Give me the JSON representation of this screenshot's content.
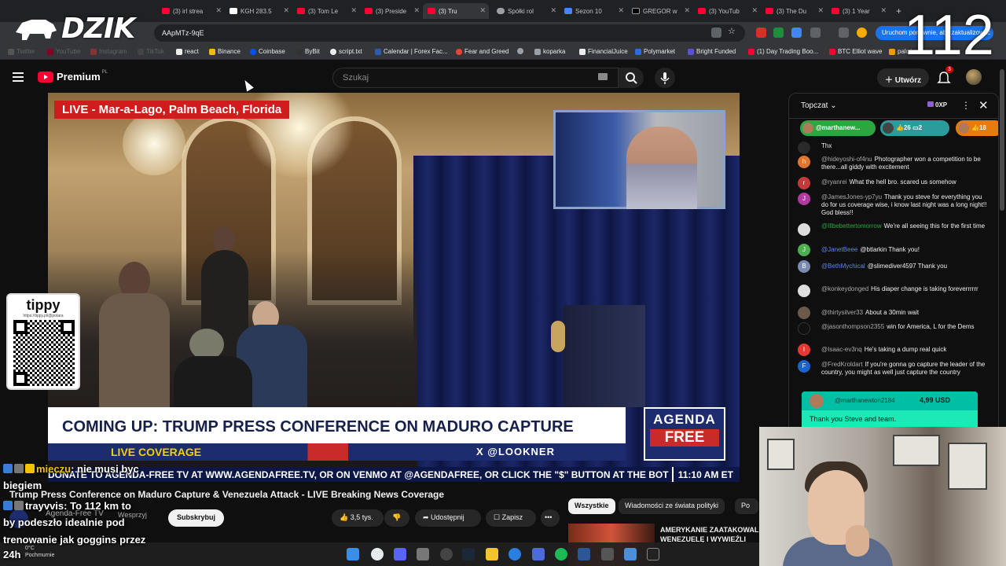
{
  "overlay": {
    "logo_text": "DZIK",
    "counter": "112"
  },
  "browser": {
    "tabs": [
      {
        "label": "(3) irl strea"
      },
      {
        "label": "KGH 283.5"
      },
      {
        "label": "(3) Tom Le"
      },
      {
        "label": "(3) Preside"
      },
      {
        "label": "(3) Tru"
      },
      {
        "label": "Spółki rol"
      },
      {
        "label": "Sezon 10"
      },
      {
        "label": "GREGOR w"
      },
      {
        "label": "(3) YouTub"
      },
      {
        "label": "(3) The Du"
      },
      {
        "label": "(3) 1 Year"
      }
    ],
    "new_tab": "+",
    "url": "AApMTz-9qE",
    "relaunch_label": "Uruchom ponownie, aby zaktualizować",
    "bookmarks": [
      {
        "label": "Twitter",
        "dim": true
      },
      {
        "label": "YouTube",
        "dim": true
      },
      {
        "label": "Instagram",
        "dim": true
      },
      {
        "label": "TikTok",
        "dim": true
      },
      {
        "label": "react",
        "dim": false
      },
      {
        "label": "Binance",
        "dim": false
      },
      {
        "label": "Coinbase",
        "dim": false
      },
      {
        "label": "ByBit",
        "dim": false
      },
      {
        "label": "script.txt",
        "dim": false
      },
      {
        "label": "Calendar | Forex Fac...",
        "dim": false
      },
      {
        "label": "Fear and Greed",
        "dim": false
      },
      {
        "label": "koparka",
        "dim": false
      },
      {
        "label": "FinancialJuice",
        "dim": false
      },
      {
        "label": "Polymarket",
        "dim": false
      },
      {
        "label": "Bright Funded",
        "dim": false
      },
      {
        "label": "(1) Day Trading Boo...",
        "dim": false
      },
      {
        "label": "BTC Elliot wave",
        "dim": false
      },
      {
        "label": "palców",
        "dim": false
      }
    ]
  },
  "youtube": {
    "brand": "Premium",
    "region": "PL",
    "search_placeholder": "Szukaj",
    "create_label": "Utwórz",
    "notifications_count": "3"
  },
  "video": {
    "live_tag": "LIVE - Mar-a-Lago, Palm Beach, Florida",
    "headline": "COMING UP: TRUMP PRESS CONFERENCE ON MADURO CAPTURE",
    "live_coverage": "LIVE COVERAGE",
    "handle": "X @LOOKNER",
    "network_top": "AGENDA",
    "network_bottom": "FREE",
    "ticker": "DONATE TO AGENDA-FREE TV AT WWW.AGENDAFREE.TV, OR ON VENMO AT @AGENDAFREE, OR CLICK THE \"$\" BUTTON AT THE BOT",
    "time": "11:10 AM ET"
  },
  "tippy": {
    "title": "tippy",
    "url": "https://tippy.pl/@potara"
  },
  "watch": {
    "title": "Trump Press Conference on Maduro Capture & Venezuela Attack - LIVE Breaking News Coverage",
    "channel": "Agenda-Free TV",
    "support_label": "Wesprzyj",
    "subscribe_label": "Subskrybuj",
    "likes": "3,5 tys.",
    "share_label": "Udostępnij",
    "save_label": "Zapisz",
    "more_label": "•••",
    "chips": [
      "Wszystkie",
      "Wiadomości ze świata polityki",
      "Po"
    ],
    "rec_title": "AMERYKANIE ZAATAKOWALI WENEZUELĘ I WYWIEŹLI"
  },
  "stream_chat": [
    {
      "user": "mieczu",
      "text": ": nie musi byc"
    },
    {
      "user": "",
      "text": "biegiem"
    },
    {
      "user": "trayvvis",
      "text": ": To 112 km to"
    },
    {
      "user": "",
      "text": "by podeszło idealnie pod"
    },
    {
      "user": "",
      "text": "trenowanie jak goggins przez"
    },
    {
      "user": "",
      "text": "24h"
    }
  ],
  "live_chat": {
    "title": "Topczat",
    "xp": "0XP",
    "pills": [
      {
        "label": "@marthanew..."
      },
      {
        "label": "26",
        "extra": "2"
      },
      {
        "label": "18"
      }
    ],
    "messages": [
      {
        "author": "",
        "text": "Thx",
        "avatar": "",
        "color": "#2a2a2a"
      },
      {
        "author": "@hideyoshi-of4nu",
        "text": "Photographer won a competition to be there...all giddy with excitement",
        "avatar": "h",
        "color": "#e0752e"
      },
      {
        "author": "@ryanrei",
        "text": "What the hell bro. scared us somehow",
        "avatar": "r",
        "color": "#c23a3a"
      },
      {
        "author": "@JamesJones-yp7yu",
        "text": "Thank you steve for everything you do for us coverage wise, i know last night was a long night!! God bless!!",
        "avatar": "J",
        "color": "#b03aa0"
      },
      {
        "author": "@Illbebettertomorrow",
        "text": "We're all seeing this for the first time",
        "avatar": "",
        "color": "#ddd"
      },
      {
        "author": "@JanetBeee",
        "text": "@btlarkin  Thank you!",
        "avatar": "J",
        "color": "#4caf50"
      },
      {
        "author": "@BethMychical",
        "text": "@slimediver4597  Thank you",
        "avatar": "B",
        "color": "#7a8bb0"
      },
      {
        "author": "@konkeydonged",
        "text": "His diaper change is taking foreverrrrrr",
        "avatar": "",
        "color": "#ddd"
      },
      {
        "author": "@thirtysilver33",
        "text": "About a 30min wait",
        "avatar": "",
        "color": "#6a5a4a"
      },
      {
        "author": "@jasonthompson2355",
        "text": "win for America, L for the Dems",
        "avatar": "",
        "color": "#111"
      },
      {
        "author": "@Isaac-ev3nq",
        "text": "He's taking a dump real quick",
        "avatar": "I",
        "color": "#e53935"
      },
      {
        "author": "@FredKroldart",
        "text": "If you're gonna go capture the leader of the country, you might as well just capture the country",
        "avatar": "F",
        "color": "#1e63c9"
      }
    ],
    "superchat": {
      "author": "@marthanewton2184",
      "amount": "4,99 USD",
      "text": "Thank you Steve and team."
    }
  },
  "taskbar": {
    "weather_temp": "0°C",
    "weather_desc": "Pochmurnie"
  }
}
